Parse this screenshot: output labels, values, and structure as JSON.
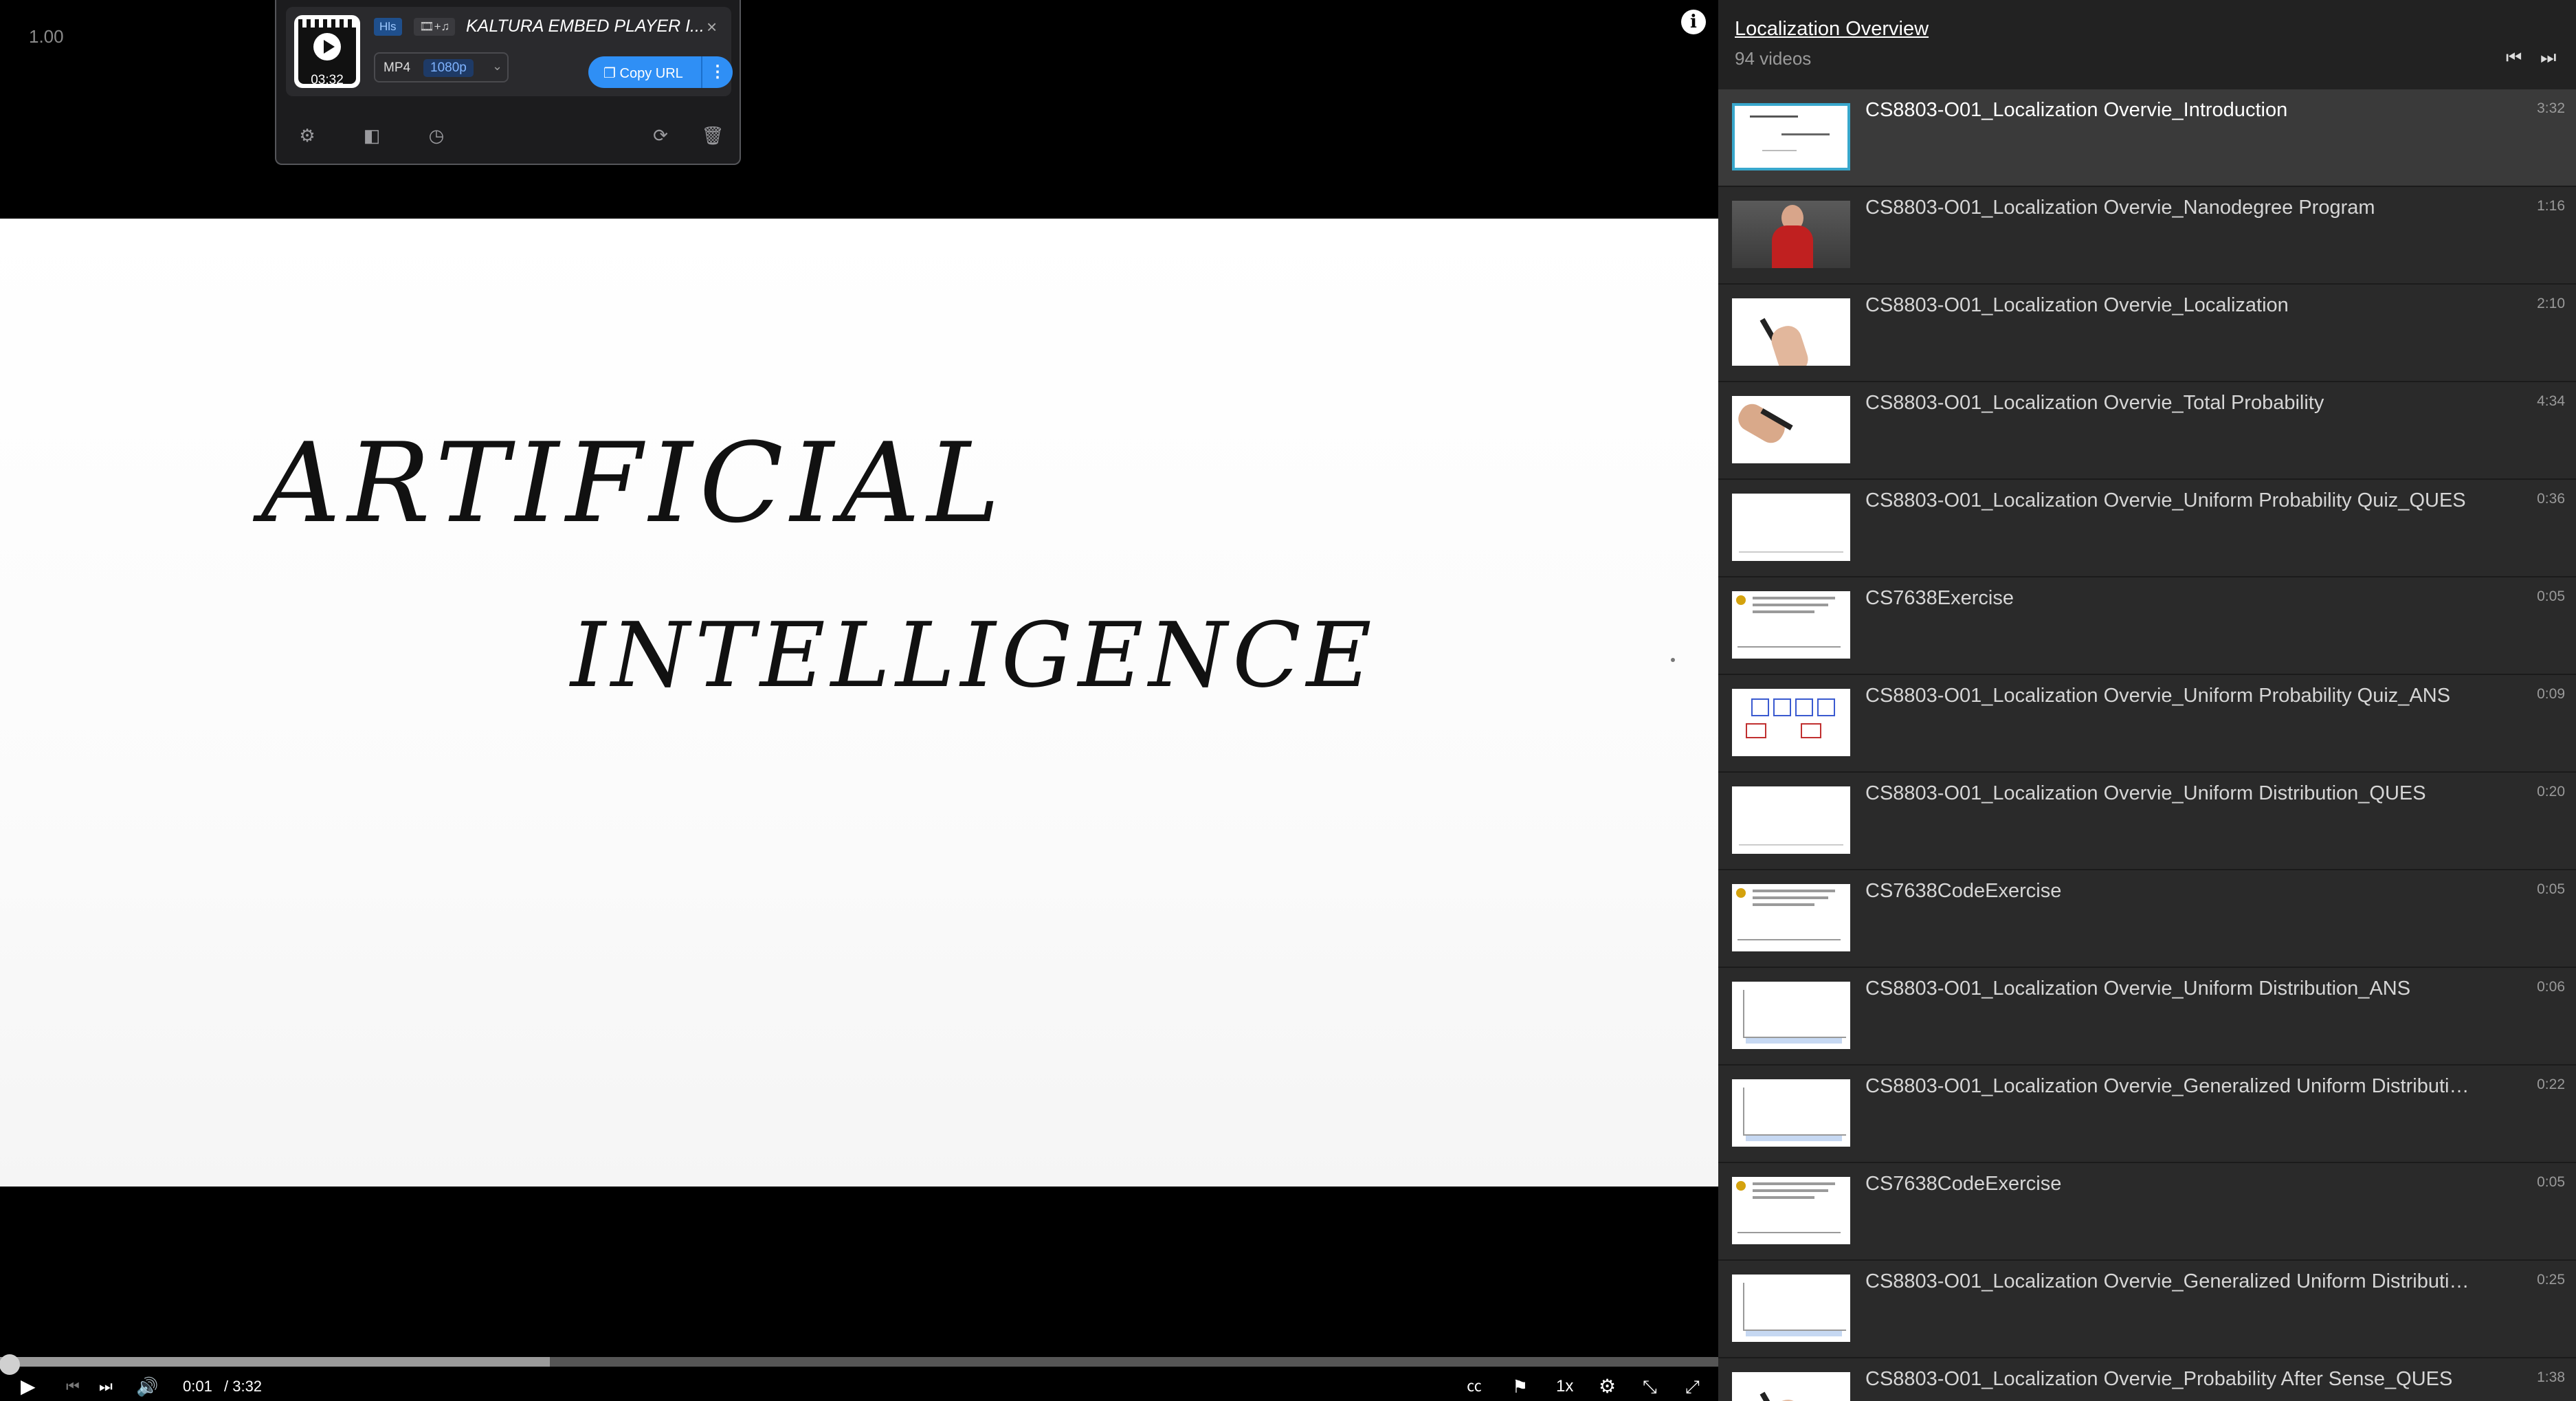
{
  "player": {
    "speed_readout": "1.00",
    "info_icon": "i",
    "video_text": [
      "ARTIFICIAL",
      "INTELLIGENCE"
    ],
    "controls": {
      "current_time": "0:01",
      "total_time": "/ 3:32",
      "playback_rate": "1x",
      "progress_fraction": 0.005,
      "buffered_fraction": 0.32,
      "icons": [
        "play-icon",
        "skip-back-icon",
        "skip-forward-icon",
        "volume-icon",
        "captions-icon",
        "flag-icon",
        "settings-icon",
        "expand-icon",
        "fullscreen-icon"
      ]
    }
  },
  "downloader": {
    "thumb_duration": "03:32",
    "stream_type": "Hls",
    "av_badge": "🎞+♫",
    "title": "KALTURA EMBED PLAYER I...",
    "close": "×",
    "format": "MP4",
    "resolution": "1080p",
    "copy_url_label": "Copy URL",
    "more": "⋮",
    "tool_icons": [
      "settings-icon",
      "sidebar-icon",
      "history-icon",
      "refresh-icon",
      "trash-icon"
    ],
    "accent_color": "#2f8ff5"
  },
  "playlist": {
    "title": "Localization Overview",
    "count": "94 videos",
    "prev": "⏮",
    "next": "⏭",
    "items": [
      {
        "name": "CS8803-O01_Localization Overvie_Introduction",
        "duration": "3:32",
        "thumb": "handwriting",
        "active": true
      },
      {
        "name": "CS8803-O01_Localization Overvie_Nanodegree Program",
        "duration": "1:16",
        "thumb": "person"
      },
      {
        "name": "CS8803-O01_Localization Overvie_Localization",
        "duration": "2:10",
        "thumb": "hand"
      },
      {
        "name": "CS8803-O01_Localization Overvie_Total Probability",
        "duration": "4:34",
        "thumb": "hand2"
      },
      {
        "name": "CS8803-O01_Localization Overvie_Uniform Probability Quiz_QUES",
        "duration": "0:36",
        "thumb": "blank"
      },
      {
        "name": "CS7638Exercise",
        "duration": "0:05",
        "thumb": "text"
      },
      {
        "name": "CS8803-O01_Localization Overvie_Uniform Probability Quiz_ANS",
        "duration": "0:09",
        "thumb": "quiz"
      },
      {
        "name": "CS8803-O01_Localization Overvie_Uniform Distribution_QUES",
        "duration": "0:20",
        "thumb": "blank"
      },
      {
        "name": "CS7638CodeExercise",
        "duration": "0:05",
        "thumb": "text"
      },
      {
        "name": "CS8803-O01_Localization Overvie_Uniform Distribution_ANS",
        "duration": "0:06",
        "thumb": "chart"
      },
      {
        "name": "CS8803-O01_Localization Overvie_Generalized Uniform Distributio...",
        "duration": "0:22",
        "thumb": "chart"
      },
      {
        "name": "CS7638CodeExercise",
        "duration": "0:05",
        "thumb": "text"
      },
      {
        "name": "CS8803-O01_Localization Overvie_Generalized Uniform Distributio...",
        "duration": "0:25",
        "thumb": "chart"
      },
      {
        "name": "CS8803-O01_Localization Overvie_Probability After Sense_QUES",
        "duration": "1:38",
        "thumb": "hand"
      }
    ]
  }
}
